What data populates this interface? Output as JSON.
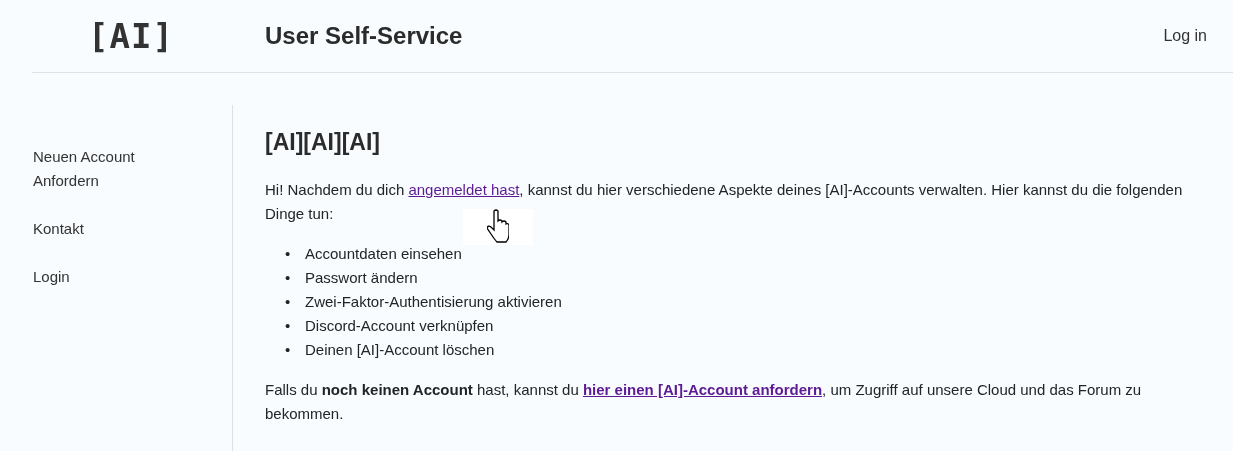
{
  "header": {
    "logo": "[AI]",
    "title": "User Self-Service",
    "login": "Log in"
  },
  "sidebar": {
    "items": [
      "Neuen Account Anfordern",
      "Kontakt",
      "Login"
    ]
  },
  "content": {
    "heading": "[AI][AI][AI]",
    "intro": {
      "before": "Hi! Nachdem du dich ",
      "link": "angemeldet hast",
      "after": ", kannst du hier verschiedene Aspekte deines [AI]-Accounts verwalten. Hier kannst du die folgenden Dinge tun:"
    },
    "bullet": "•",
    "features": [
      "Accountdaten einsehen",
      "Passwort ändern",
      "Zwei-Faktor-Authentisierung aktivieren",
      "Discord-Account verknüpfen",
      "Deinen [AI]-Account löschen"
    ],
    "outro": {
      "before": "Falls du **noch keinen Account** hast, kannst du ",
      "link": "hier einen [AI]-Account anfordern",
      "after": ", um Zugriff auf unsere Cloud und das Forum zu bekommen."
    }
  }
}
